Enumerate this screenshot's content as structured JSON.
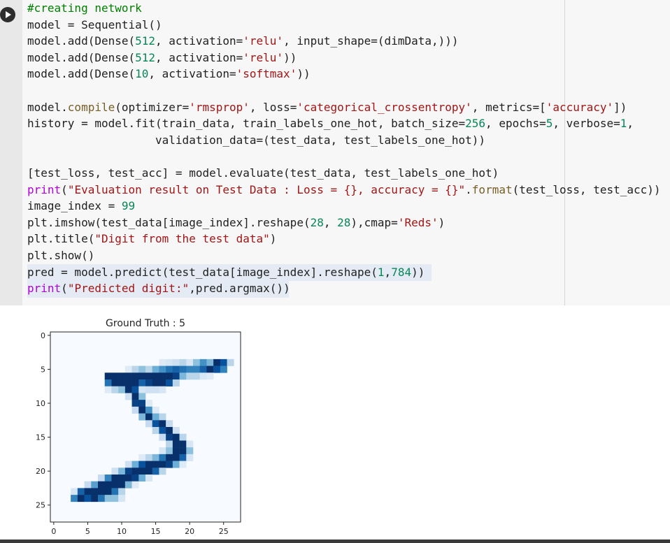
{
  "cell": {
    "code_lines": [
      [
        {
          "t": "#creating network",
          "c": "cm"
        }
      ],
      [
        {
          "t": "model = Sequential()",
          "c": "kw"
        }
      ],
      [
        {
          "t": "model.add(Dense(",
          "c": "kw"
        },
        {
          "t": "512",
          "c": "num"
        },
        {
          "t": ", activation=",
          "c": "kw"
        },
        {
          "t": "'relu'",
          "c": "str"
        },
        {
          "t": ", input_shape=(dimData,)))",
          "c": "kw"
        }
      ],
      [
        {
          "t": "model.add(Dense(",
          "c": "kw"
        },
        {
          "t": "512",
          "c": "num"
        },
        {
          "t": ", activation=",
          "c": "kw"
        },
        {
          "t": "'relu'",
          "c": "str"
        },
        {
          "t": "))",
          "c": "kw"
        }
      ],
      [
        {
          "t": "model.add(Dense(",
          "c": "kw"
        },
        {
          "t": "10",
          "c": "num"
        },
        {
          "t": ", activation=",
          "c": "kw"
        },
        {
          "t": "'softmax'",
          "c": "str"
        },
        {
          "t": "))",
          "c": "kw"
        }
      ],
      [
        {
          "t": "",
          "c": "kw"
        }
      ],
      [
        {
          "t": "model.",
          "c": "kw"
        },
        {
          "t": "compile",
          "c": "fn"
        },
        {
          "t": "(optimizer=",
          "c": "kw"
        },
        {
          "t": "'rmsprop'",
          "c": "str"
        },
        {
          "t": ", loss=",
          "c": "kw"
        },
        {
          "t": "'categorical_crossentropy'",
          "c": "str"
        },
        {
          "t": ", metrics=[",
          "c": "kw"
        },
        {
          "t": "'accuracy'",
          "c": "str"
        },
        {
          "t": "])",
          "c": "kw"
        }
      ],
      [
        {
          "t": "history = model.fit(train_data, train_labels_one_hot, batch_size=",
          "c": "kw"
        },
        {
          "t": "256",
          "c": "num"
        },
        {
          "t": ", epochs=",
          "c": "kw"
        },
        {
          "t": "5",
          "c": "num"
        },
        {
          "t": ", verbose=",
          "c": "kw"
        },
        {
          "t": "1",
          "c": "num"
        },
        {
          "t": ",",
          "c": "kw"
        }
      ],
      [
        {
          "t": "                   validation_data=(test_data, test_labels_one_hot))",
          "c": "kw"
        }
      ],
      [
        {
          "t": "",
          "c": "kw"
        }
      ],
      [
        {
          "t": "[test_loss, test_acc] = model.evaluate(test_data, test_labels_one_hot)",
          "c": "kw"
        }
      ],
      [
        {
          "t": "print",
          "c": "purple"
        },
        {
          "t": "(",
          "c": "kw"
        },
        {
          "t": "\"Evaluation result on Test Data : Loss = {}, accuracy = {}\"",
          "c": "str"
        },
        {
          "t": ".",
          "c": "kw"
        },
        {
          "t": "format",
          "c": "fn"
        },
        {
          "t": "(test_loss, test_acc))",
          "c": "kw"
        }
      ],
      [
        {
          "t": "image_index = ",
          "c": "kw"
        },
        {
          "t": "99",
          "c": "num"
        }
      ],
      [
        {
          "t": "plt.imshow(test_data[image_index].reshape(",
          "c": "kw"
        },
        {
          "t": "28",
          "c": "num"
        },
        {
          "t": ", ",
          "c": "kw"
        },
        {
          "t": "28",
          "c": "num"
        },
        {
          "t": "),cmap=",
          "c": "kw"
        },
        {
          "t": "'Reds'",
          "c": "str"
        },
        {
          "t": ")",
          "c": "kw"
        }
      ],
      [
        {
          "t": "plt.title(",
          "c": "kw"
        },
        {
          "t": "\"Digit from the test data\"",
          "c": "str"
        },
        {
          "t": ")",
          "c": "kw"
        }
      ],
      [
        {
          "t": "plt.show()",
          "c": "kw"
        }
      ],
      [
        {
          "t": "pred = model.predict(test_data[image_index].reshape(",
          "c": "kw"
        },
        {
          "t": "1",
          "c": "num"
        },
        {
          "t": ",",
          "c": "kw"
        },
        {
          "t": "784",
          "c": "num"
        },
        {
          "t": "))",
          "c": "kw"
        }
      ],
      [
        {
          "t": "print",
          "c": "purple"
        },
        {
          "t": "(",
          "c": "kw"
        },
        {
          "t": "\"Predicted digit:\"",
          "c": "str"
        },
        {
          "t": ",pred.argmax())",
          "c": "kw"
        }
      ]
    ]
  },
  "output": {
    "plot_title": "Ground Truth : 5",
    "x_ticks": [
      "0",
      "5",
      "10",
      "15",
      "20",
      "25"
    ],
    "y_ticks": [
      "0",
      "5",
      "10",
      "15",
      "20",
      "25"
    ],
    "colormap": "Blues"
  },
  "chart_data": {
    "type": "heatmap",
    "title": "Ground Truth : 5",
    "xlabel": "",
    "ylabel": "",
    "xlim": [
      -0.5,
      27.5
    ],
    "ylim": [
      27.5,
      -0.5
    ],
    "colormap": "Blues",
    "grid": false,
    "note_values": "intensity 0-1, sparse list of [row, col, value]",
    "cells": [
      [
        4,
        16,
        0.15
      ],
      [
        4,
        17,
        0.2
      ],
      [
        4,
        18,
        0.25
      ],
      [
        4,
        19,
        0.35
      ],
      [
        4,
        20,
        0.2
      ],
      [
        4,
        21,
        0.5
      ],
      [
        4,
        22,
        0.7
      ],
      [
        4,
        23,
        0.55
      ],
      [
        4,
        24,
        1.0
      ],
      [
        4,
        25,
        0.9
      ],
      [
        4,
        26,
        0.35
      ],
      [
        5,
        11,
        0.15
      ],
      [
        5,
        12,
        0.35
      ],
      [
        5,
        13,
        0.5
      ],
      [
        5,
        14,
        0.35
      ],
      [
        5,
        15,
        0.6
      ],
      [
        5,
        16,
        0.7
      ],
      [
        5,
        17,
        0.8
      ],
      [
        5,
        18,
        0.85
      ],
      [
        5,
        19,
        0.8
      ],
      [
        5,
        20,
        0.75
      ],
      [
        5,
        21,
        0.75
      ],
      [
        5,
        22,
        0.85
      ],
      [
        5,
        23,
        1.0
      ],
      [
        5,
        24,
        0.9
      ],
      [
        5,
        25,
        0.75
      ],
      [
        6,
        8,
        1.0
      ],
      [
        6,
        9,
        1.0
      ],
      [
        6,
        10,
        1.0
      ],
      [
        6,
        11,
        1.0
      ],
      [
        6,
        12,
        1.0
      ],
      [
        6,
        13,
        1.0
      ],
      [
        6,
        14,
        1.0
      ],
      [
        6,
        15,
        1.0
      ],
      [
        6,
        16,
        1.0
      ],
      [
        6,
        17,
        1.0
      ],
      [
        6,
        18,
        0.95
      ],
      [
        6,
        19,
        0.55
      ],
      [
        6,
        20,
        0.35
      ],
      [
        6,
        21,
        0.35
      ],
      [
        6,
        22,
        0.2
      ],
      [
        6,
        23,
        0.15
      ],
      [
        7,
        8,
        0.8
      ],
      [
        7,
        9,
        1.0
      ],
      [
        7,
        10,
        1.0
      ],
      [
        7,
        11,
        1.0
      ],
      [
        7,
        12,
        1.0
      ],
      [
        7,
        13,
        0.85
      ],
      [
        7,
        14,
        0.95
      ],
      [
        7,
        15,
        1.0
      ],
      [
        7,
        16,
        1.0
      ],
      [
        7,
        17,
        0.9
      ],
      [
        7,
        18,
        0.35
      ],
      [
        8,
        8,
        0.15
      ],
      [
        8,
        9,
        0.35
      ],
      [
        8,
        10,
        0.5
      ],
      [
        8,
        11,
        1.0
      ],
      [
        8,
        12,
        0.9
      ],
      [
        8,
        13,
        0.2
      ],
      [
        8,
        14,
        0.25
      ],
      [
        8,
        15,
        0.25
      ],
      [
        8,
        16,
        0.2
      ],
      [
        9,
        11,
        0.25
      ],
      [
        9,
        12,
        1.0
      ],
      [
        9,
        13,
        0.5
      ],
      [
        10,
        12,
        0.95
      ],
      [
        10,
        13,
        0.95
      ],
      [
        10,
        14,
        0.15
      ],
      [
        11,
        12,
        0.3
      ],
      [
        11,
        13,
        1.0
      ],
      [
        11,
        14,
        0.7
      ],
      [
        11,
        15,
        0.15
      ],
      [
        12,
        13,
        0.55
      ],
      [
        12,
        14,
        1.0
      ],
      [
        12,
        15,
        0.6
      ],
      [
        12,
        16,
        0.35
      ],
      [
        13,
        14,
        0.3
      ],
      [
        13,
        15,
        0.9
      ],
      [
        13,
        16,
        1.0
      ],
      [
        13,
        17,
        0.3
      ],
      [
        14,
        15,
        0.35
      ],
      [
        14,
        16,
        0.9
      ],
      [
        14,
        17,
        1.0
      ],
      [
        14,
        18,
        0.25
      ],
      [
        15,
        16,
        0.3
      ],
      [
        15,
        17,
        0.95
      ],
      [
        15,
        18,
        1.0
      ],
      [
        15,
        19,
        0.35
      ],
      [
        16,
        17,
        0.35
      ],
      [
        16,
        18,
        1.0
      ],
      [
        16,
        19,
        1.0
      ],
      [
        16,
        20,
        0.2
      ],
      [
        17,
        16,
        0.2
      ],
      [
        17,
        17,
        0.5
      ],
      [
        17,
        18,
        1.0
      ],
      [
        17,
        19,
        1.0
      ],
      [
        17,
        20,
        0.5
      ],
      [
        18,
        13,
        0.15
      ],
      [
        18,
        14,
        0.35
      ],
      [
        18,
        15,
        0.55
      ],
      [
        18,
        16,
        0.8
      ],
      [
        18,
        17,
        1.0
      ],
      [
        18,
        18,
        1.0
      ],
      [
        18,
        19,
        0.85
      ],
      [
        18,
        20,
        0.2
      ],
      [
        19,
        11,
        0.25
      ],
      [
        19,
        12,
        0.6
      ],
      [
        19,
        13,
        0.9
      ],
      [
        19,
        14,
        1.0
      ],
      [
        19,
        15,
        1.0
      ],
      [
        19,
        16,
        1.0
      ],
      [
        19,
        17,
        0.95
      ],
      [
        19,
        18,
        0.6
      ],
      [
        19,
        19,
        0.15
      ],
      [
        20,
        9,
        0.25
      ],
      [
        20,
        10,
        0.55
      ],
      [
        20,
        11,
        0.95
      ],
      [
        20,
        12,
        1.0
      ],
      [
        20,
        13,
        1.0
      ],
      [
        20,
        14,
        1.0
      ],
      [
        20,
        15,
        0.85
      ],
      [
        20,
        16,
        0.35
      ],
      [
        21,
        7,
        0.3
      ],
      [
        21,
        8,
        0.75
      ],
      [
        21,
        9,
        1.0
      ],
      [
        21,
        10,
        1.0
      ],
      [
        21,
        11,
        1.0
      ],
      [
        21,
        12,
        0.95
      ],
      [
        21,
        13,
        0.6
      ],
      [
        21,
        14,
        0.2
      ],
      [
        22,
        5,
        0.3
      ],
      [
        22,
        6,
        0.65
      ],
      [
        22,
        7,
        1.0
      ],
      [
        22,
        8,
        1.0
      ],
      [
        22,
        9,
        1.0
      ],
      [
        22,
        10,
        1.0
      ],
      [
        22,
        11,
        0.55
      ],
      [
        22,
        12,
        0.15
      ],
      [
        23,
        3,
        0.2
      ],
      [
        23,
        4,
        0.85
      ],
      [
        23,
        5,
        1.0
      ],
      [
        23,
        6,
        1.0
      ],
      [
        23,
        7,
        1.0
      ],
      [
        23,
        8,
        1.0
      ],
      [
        23,
        9,
        0.8
      ],
      [
        23,
        10,
        0.35
      ],
      [
        24,
        3,
        0.75
      ],
      [
        24,
        4,
        1.0
      ],
      [
        24,
        5,
        0.9
      ],
      [
        24,
        6,
        1.0
      ],
      [
        24,
        7,
        0.8
      ],
      [
        24,
        8,
        0.5
      ],
      [
        24,
        9,
        0.5
      ],
      [
        24,
        10,
        0.2
      ]
    ]
  }
}
